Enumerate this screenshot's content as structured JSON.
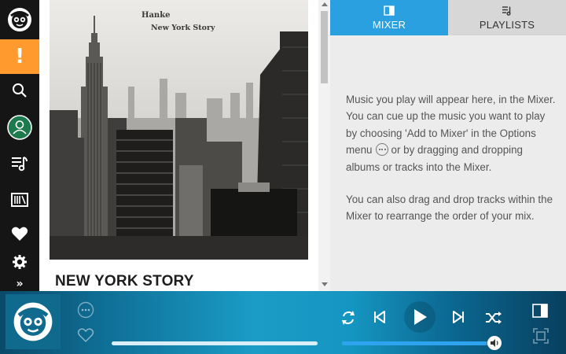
{
  "nav": {
    "items": [
      {
        "name": "logo",
        "icon": "napster-logo-icon"
      },
      {
        "name": "alerts",
        "icon": "exclamation-icon",
        "glyph": "!",
        "color": "#ff9a2e"
      },
      {
        "name": "search",
        "icon": "search-icon"
      },
      {
        "name": "account",
        "icon": "account-icon"
      },
      {
        "name": "playlists",
        "icon": "playlist-icon"
      },
      {
        "name": "library",
        "icon": "library-icon"
      },
      {
        "name": "favorites",
        "icon": "heart-icon"
      },
      {
        "name": "settings",
        "icon": "gear-icon"
      },
      {
        "name": "expand",
        "icon": "double-chevron-right-icon",
        "glyph": "»"
      }
    ]
  },
  "album": {
    "cover_artist": "Hanke",
    "cover_title": "New York Story",
    "title": "NEW YORK STORY"
  },
  "right_panel": {
    "tabs": [
      {
        "label": "MIXER",
        "icon": "mixer-panel-icon",
        "active": true
      },
      {
        "label": "PLAYLISTS",
        "icon": "playlist-icon",
        "active": false
      }
    ],
    "mixer_text_1a": "Music you play will appear here, in the Mixer. You can cue up the music you want to play by choosing 'Add to Mixer' in the Options menu",
    "mixer_text_1b": "or by dragging and dropping albums or tracks into the Mixer.",
    "mixer_text_2": "You can also drag and drop tracks within the Mixer to rearrange the order of your mix."
  },
  "player": {
    "progress": 1.0,
    "volume": 0.95,
    "controls": [
      "more-options",
      "favorite",
      "repeat",
      "previous",
      "play",
      "next",
      "shuffle",
      "mixer-toggle",
      "fullscreen"
    ],
    "colors": {
      "accent": "#2aa0e0",
      "volume_fill": "#2ea3f0",
      "alert": "#ff9a2e"
    }
  }
}
